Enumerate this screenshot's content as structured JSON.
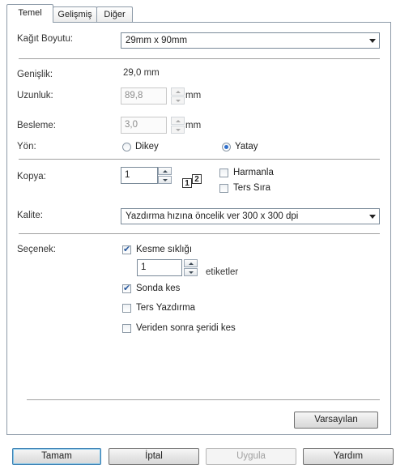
{
  "tabs": [
    "Temel",
    "Gelişmiş",
    "Diğer"
  ],
  "paper_size": {
    "label": "Kağıt Boyutu:",
    "value": "29mm x 90mm"
  },
  "width": {
    "label": "Genişlik:",
    "value": "29,0 mm"
  },
  "length": {
    "label": "Uzunluk:",
    "value": "89,8",
    "unit": "mm"
  },
  "feed": {
    "label": "Besleme:",
    "value": "3,0",
    "unit": "mm"
  },
  "orientation": {
    "label": "Yön:",
    "options": [
      "Dikey",
      "Yatay"
    ],
    "selected": "Yatay"
  },
  "copies": {
    "label": "Kopya:",
    "value": "1",
    "icon_pages": [
      "1",
      "2"
    ],
    "collate": {
      "label": "Harmanla",
      "checked": false
    },
    "reverse": {
      "label": "Ters Sıra",
      "checked": false
    }
  },
  "quality": {
    "label": "Kalite:",
    "value": "Yazdırma hızına öncelik ver 300 x 300 dpi"
  },
  "options": {
    "label": "Seçenek:",
    "cut_every": {
      "label": "Kesme sıklığı",
      "checked": true,
      "value": "1",
      "unit": "etiketler"
    },
    "cut_at_end": {
      "label": "Sonda kes",
      "checked": true
    },
    "mirror": {
      "label": "Ters Yazdırma",
      "checked": false
    },
    "cut_after_data": {
      "label": "Veriden sonra şeridi kes",
      "checked": false
    }
  },
  "defaults_button": "Varsayılan",
  "buttons": {
    "ok": "Tamam",
    "cancel": "İptal",
    "apply": "Uygula",
    "help": "Yardım"
  },
  "colors": {
    "accent": "#2f6fcc",
    "border": "#8d9aa8"
  }
}
